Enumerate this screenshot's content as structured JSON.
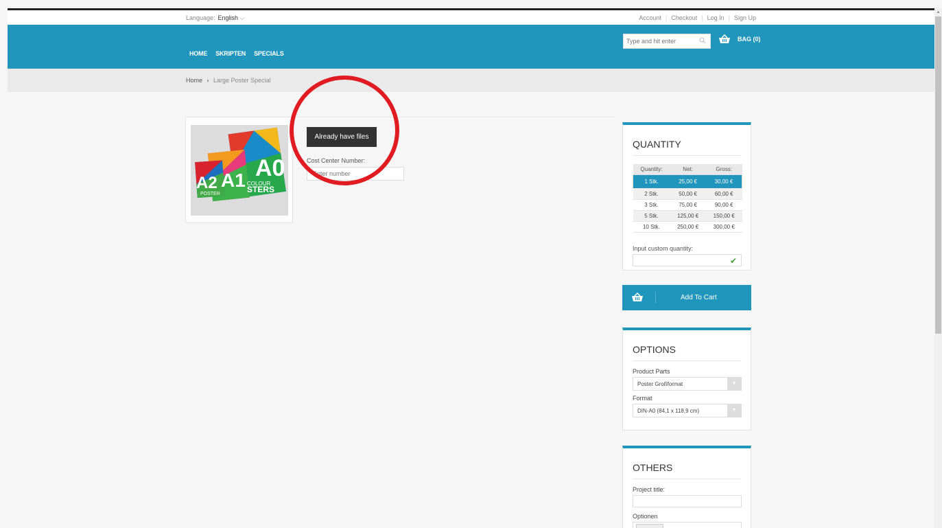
{
  "topbar": {
    "language_label": "Language:",
    "language_value": "English",
    "links": [
      "Account",
      "Checkout",
      "Log In",
      "Sign Up"
    ]
  },
  "nav": {
    "items": [
      "HOME",
      "SKRIPTEN",
      "SPECIALS"
    ],
    "search_placeholder": "Type and hit enter",
    "bag_label": "BAG (0)"
  },
  "breadcrumb": {
    "home": "Home",
    "separator": "›",
    "current": "Large Poster Special"
  },
  "product": {
    "image_text": [
      "A2",
      "A1",
      "A0",
      "POSTER",
      "COLOUR",
      "STERS"
    ],
    "files_button": "Already have files",
    "cost_center_label": "Cost Center Number:",
    "cost_center_placeholder": "Enter number"
  },
  "quantity": {
    "title": "QUANTITY",
    "headers": [
      "Quantity:",
      "Net:",
      "Gross:"
    ],
    "rows": [
      [
        "1 Stk.",
        "25,00 €",
        "30,00 €"
      ],
      [
        "2 Stk.",
        "50,00 €",
        "60,00 €"
      ],
      [
        "3 Stk.",
        "75,00 €",
        "90,00 €"
      ],
      [
        "5 Stk.",
        "125,00 €",
        "150,00 €"
      ],
      [
        "10 Stk.",
        "250,00 €",
        "300,00 €"
      ]
    ],
    "custom_label": "Input custom quantity:"
  },
  "cart": {
    "add_label": "Add To Cart"
  },
  "options": {
    "title": "OPTIONS",
    "product_parts_label": "Product Parts",
    "product_parts_value": "Poster Großformat",
    "format_label": "Format",
    "format_value": "DIN-A0 (84,1 x 118,9 cm)"
  },
  "others": {
    "title": "OTHERS",
    "project_title_label": "Project title:",
    "optionen_label": "Optionen"
  },
  "colors": {
    "accent": "#2196bd",
    "highlight_ring": "#e11b22"
  }
}
